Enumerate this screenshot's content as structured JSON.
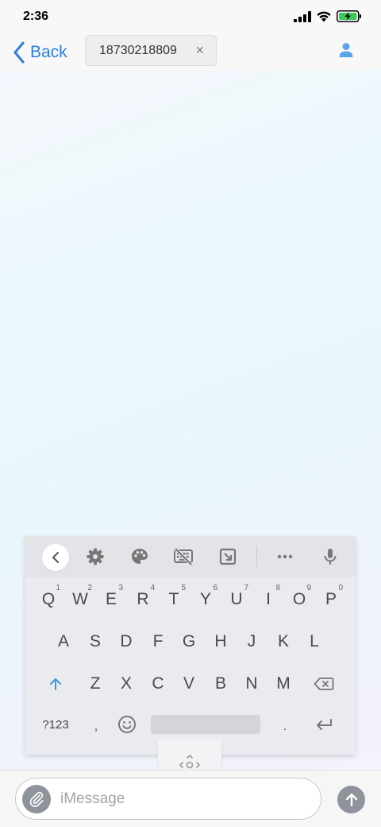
{
  "status_bar": {
    "time": "2:36",
    "icons": [
      "cellular-signal-icon",
      "wifi-icon",
      "battery-charging-icon"
    ],
    "battery_color": "#3cc95a"
  },
  "nav": {
    "back_label": "Back",
    "recipient": "18730218809",
    "remove_symbol": "×",
    "accent_color": "#2d7fdc"
  },
  "keyboard": {
    "toolbar_icons": [
      "chevron-left-icon",
      "gear-icon",
      "palette-icon",
      "keyboard-off-icon",
      "resize-icon",
      "more-icon",
      "microphone-icon"
    ],
    "row1": [
      {
        "label": "Q",
        "hint": "1"
      },
      {
        "label": "W",
        "hint": "2"
      },
      {
        "label": "E",
        "hint": "3"
      },
      {
        "label": "R",
        "hint": "4"
      },
      {
        "label": "T",
        "hint": "5"
      },
      {
        "label": "Y",
        "hint": "6"
      },
      {
        "label": "U",
        "hint": "7"
      },
      {
        "label": "I",
        "hint": "8"
      },
      {
        "label": "O",
        "hint": "9"
      },
      {
        "label": "P",
        "hint": "0"
      }
    ],
    "row2": [
      "A",
      "S",
      "D",
      "F",
      "G",
      "H",
      "J",
      "K",
      "L"
    ],
    "row3": [
      "Z",
      "X",
      "C",
      "V",
      "B",
      "N",
      "M"
    ],
    "symbols_label": "?123",
    "comma": ",",
    "period": "."
  },
  "composer": {
    "placeholder": "iMessage",
    "value": ""
  }
}
